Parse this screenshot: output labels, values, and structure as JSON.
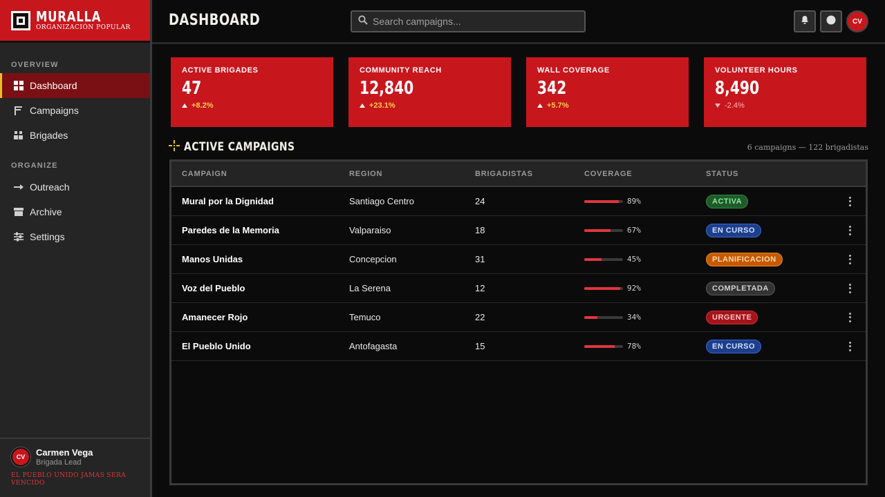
{
  "brand": {
    "title": "MURALLA",
    "subtitle": "ORGANIZACIÓN POPULAR"
  },
  "sidebar": {
    "sections": [
      "OVERVIEW",
      "ORGANIZE"
    ],
    "items": [
      {
        "label": "Dashboard",
        "icon": "grid-icon",
        "active": true
      },
      {
        "label": "Campaigns",
        "icon": "flag-icon"
      },
      {
        "label": "Brigades",
        "icon": "users-icon"
      },
      {
        "label": "Outreach",
        "icon": "arrow-right-icon"
      },
      {
        "label": "Archive",
        "icon": "archive-icon"
      },
      {
        "label": "Settings",
        "icon": "sliders-icon"
      }
    ],
    "user": {
      "initials": "CV",
      "name": "Carmen Vega",
      "role": "Brigada Lead"
    },
    "motto": "EL PUEBLO UNIDO JAMAS SERA VENCIDO"
  },
  "header": {
    "title": "DASHBOARD",
    "search_placeholder": "Search campaigns...",
    "avatar_initials": "CV"
  },
  "stats": [
    {
      "label": "ACTIVE BRIGADES",
      "value": "47",
      "delta": "+8.2%",
      "trend": "up"
    },
    {
      "label": "COMMUNITY REACH",
      "value": "12,840",
      "delta": "+23.1%",
      "trend": "up"
    },
    {
      "label": "WALL COVERAGE",
      "value": "342",
      "delta": "+5.7%",
      "trend": "up"
    },
    {
      "label": "VOLUNTEER HOURS",
      "value": "8,490",
      "delta": "-2.4%",
      "trend": "down"
    }
  ],
  "campaigns": {
    "title": "ACTIVE CAMPAIGNS",
    "meta": "6 campaigns — 122 brigadistas",
    "columns": [
      "CAMPAIGN",
      "REGION",
      "BRIGADISTAS",
      "COVERAGE",
      "STATUS"
    ],
    "rows": [
      {
        "name": "Mural por la Dignidad",
        "region": "Santiago Centro",
        "brigadistas": "24",
        "coverage": 89,
        "coverage_label": "89%",
        "status": "ACTIVA",
        "status_kind": "activa"
      },
      {
        "name": "Paredes de la Memoria",
        "region": "Valparaiso",
        "brigadistas": "18",
        "coverage": 67,
        "coverage_label": "67%",
        "status": "EN CURSO",
        "status_kind": "curso"
      },
      {
        "name": "Manos Unidas",
        "region": "Concepcion",
        "brigadistas": "31",
        "coverage": 45,
        "coverage_label": "45%",
        "status": "PLANIFICACION",
        "status_kind": "plan"
      },
      {
        "name": "Voz del Pueblo",
        "region": "La Serena",
        "brigadistas": "12",
        "coverage": 92,
        "coverage_label": "92%",
        "status": "COMPLETADA",
        "status_kind": "done"
      },
      {
        "name": "Amanecer Rojo",
        "region": "Temuco",
        "brigadistas": "22",
        "coverage": 34,
        "coverage_label": "34%",
        "status": "URGENTE",
        "status_kind": "urgente"
      },
      {
        "name": "El Pueblo Unido",
        "region": "Antofagasta",
        "brigadistas": "15",
        "coverage": 78,
        "coverage_label": "78%",
        "status": "EN CURSO",
        "status_kind": "curso"
      }
    ]
  },
  "colors": {
    "brand_red": "#c8161d",
    "accent_yellow": "#e7c21e",
    "status": {
      "activa": {
        "bg": "#1f5b2a",
        "border": "#2f8a3e",
        "fg": "#8ee59b"
      },
      "curso": {
        "bg": "#1d3e8a",
        "border": "#3a66d6",
        "fg": "#cfe0ff"
      },
      "plan": {
        "bg": "#c55a06",
        "border": "#f08a1c",
        "fg": "#ffd9a8"
      },
      "done": {
        "bg": "#333333",
        "border": "#5a5a5a",
        "fg": "#d0d0d0"
      },
      "urgente": {
        "bg": "#a4141b",
        "border": "#d62a32",
        "fg": "#ffc2c4"
      }
    }
  }
}
